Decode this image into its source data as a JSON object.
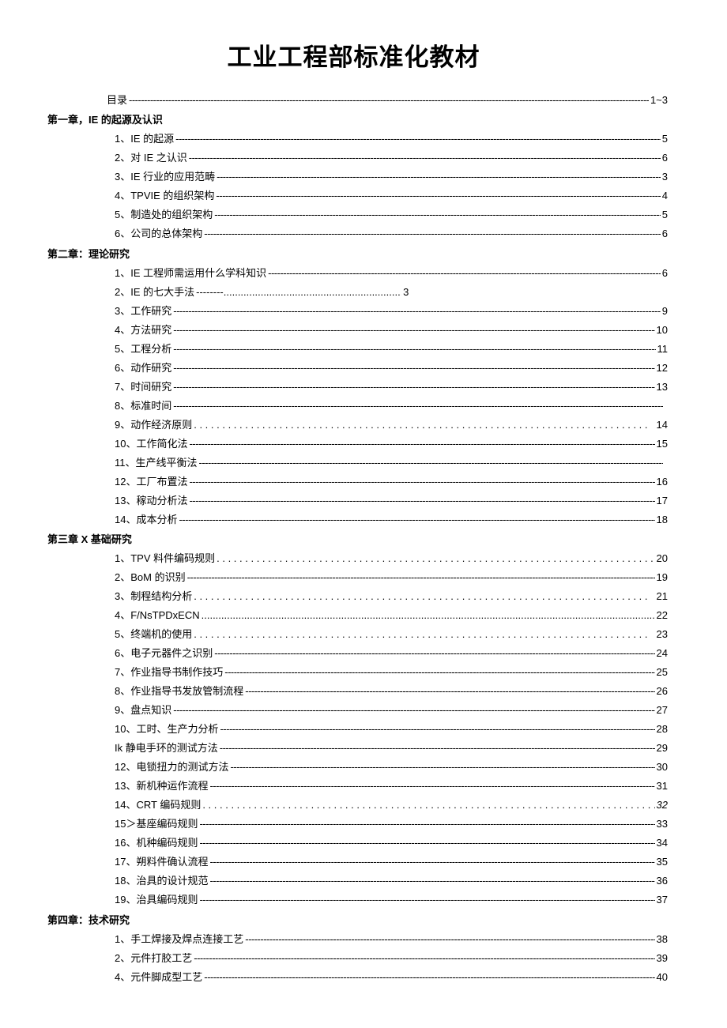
{
  "title": "工业工程部标准化教材",
  "toc_label": "目录",
  "toc_page": "1~3",
  "chapters": [
    {
      "heading": "第一章，IE 的起源及认识",
      "items": [
        {
          "label": "1、IE 的起源",
          "page": "5",
          "leader": "dash"
        },
        {
          "label": "2、对 IE 之认识",
          "page": "6",
          "leader": "dash"
        },
        {
          "label": "3、IE 行业的应用范畴",
          "page": "3",
          "leader": "dash"
        },
        {
          "label": "4、TPVIE 的组织架构",
          "page": "4",
          "leader": "dash"
        },
        {
          "label": "5、制造处的组织架构",
          "page": "5",
          "leader": "dash"
        },
        {
          "label": "6、公司的总体架构",
          "page": "6",
          "leader": "dash"
        }
      ]
    },
    {
      "heading": "第二章：理论研究",
      "items": [
        {
          "label": "1、IE 工程师需运用什么学科知识",
          "page": "6",
          "leader": "dash"
        },
        {
          "label": "2、IE 的七大手法",
          "page": "3",
          "leader": "mix",
          "short": true
        },
        {
          "label": "3、工作研究",
          "page": "9",
          "leader": "dash"
        },
        {
          "label": "4、方法研究",
          "page": "10",
          "leader": "dash"
        },
        {
          "label": "5、工程分析",
          "page": "11",
          "leader": "dash"
        },
        {
          "label": "6、动作研究",
          "page": "12",
          "leader": "dash"
        },
        {
          "label": "7、时间研究",
          "page": "13",
          "leader": "dash"
        },
        {
          "label": "8、标准时间",
          "page": "",
          "leader": "dash",
          "nopage": true
        },
        {
          "label": "9、动作经济原则",
          "page": "14",
          "leader": "dot"
        },
        {
          "label": "10、工作简化法",
          "page": "15",
          "leader": "dash"
        },
        {
          "label": "11、生产线平衡法",
          "page": "",
          "leader": "dash",
          "nopage": true
        },
        {
          "label": "12、工厂布置法",
          "page": "16",
          "leader": "dash"
        },
        {
          "label": "13、稼动分析法",
          "page": "17",
          "leader": "dash"
        },
        {
          "label": "14、成本分析",
          "page": "18",
          "leader": "dash"
        }
      ]
    },
    {
      "heading": "第三章 X 基础研究",
      "items": [
        {
          "label": "1、TPV 料件编码规则",
          "page": "20",
          "leader": "dot"
        },
        {
          "label": "2、BoM 的识别",
          "page": "19",
          "leader": "dash"
        },
        {
          "label": "3、制程结构分析",
          "page": "21",
          "leader": "dot"
        },
        {
          "label": "4、F/NsTPDxECN",
          "page": "22",
          "leader": "dots-tight"
        },
        {
          "label": "5、终端机的使用",
          "page": "23",
          "leader": "dot"
        },
        {
          "label": "6、电子元器件之识别",
          "page": "24",
          "leader": "dash"
        },
        {
          "label": "7、作业指导书制作技巧",
          "page": "25",
          "leader": "dash"
        },
        {
          "label": "8、作业指导书发放管制流程",
          "page": "26",
          "leader": "dash"
        },
        {
          "label": "9、盘点知识",
          "page": "27",
          "leader": "dash"
        },
        {
          "label": "10、工时、生产力分析",
          "page": "28",
          "leader": "dash"
        },
        {
          "label": "Ik 静电手环的测试方法",
          "page": "29",
          "leader": "dash"
        },
        {
          "label": "12、电锁扭力的测试方法",
          "page": "30",
          "leader": "dash"
        },
        {
          "label": "13、新机种运作流程",
          "page": "31",
          "leader": "dash"
        },
        {
          "label": "14、CRT 编码规则",
          "page": "32",
          "leader": "dot",
          "italic": true
        },
        {
          "label": "15＞基座编码规则",
          "page": "33",
          "leader": "dash"
        },
        {
          "label": "16、机种编码规则",
          "page": "34",
          "leader": "dash"
        },
        {
          "label": "17、朔料件确认流程",
          "page": "35",
          "leader": "dash"
        },
        {
          "label": "18、治具的设计规范",
          "page": "36",
          "leader": "dash"
        },
        {
          "label": "19、治具编码规则",
          "page": "37",
          "leader": "dash"
        }
      ]
    },
    {
      "heading": "第四章：技术研究",
      "items": [
        {
          "label": "1、手工焊接及焊点连接工艺",
          "page": "38",
          "leader": "dash"
        },
        {
          "label": "2、元件打胶工艺",
          "page": "39",
          "leader": "dash"
        },
        {
          "label": "4、元件脚成型工艺",
          "page": "40",
          "leader": "dash"
        }
      ]
    }
  ]
}
